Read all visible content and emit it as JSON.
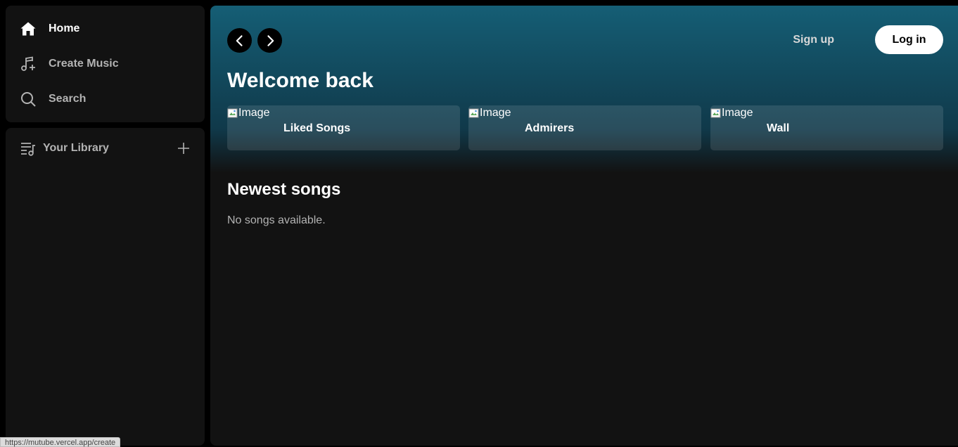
{
  "sidebar": {
    "nav": [
      {
        "label": "Home",
        "icon": "home-icon",
        "active": true
      },
      {
        "label": "Create Music",
        "icon": "music-plus-icon",
        "active": false
      },
      {
        "label": "Search",
        "icon": "search-icon",
        "active": false
      }
    ],
    "library": {
      "label": "Your Library",
      "icon": "library-icon",
      "add_icon": "plus-icon"
    }
  },
  "header": {
    "back_icon": "chevron-left-icon",
    "forward_icon": "chevron-right-icon",
    "signup_label": "Sign up",
    "login_label": "Log in"
  },
  "main": {
    "welcome_title": "Welcome back",
    "cards": [
      {
        "image_alt": "Image",
        "title": "Liked Songs"
      },
      {
        "image_alt": "Image",
        "title": "Admirers"
      },
      {
        "image_alt": "Image",
        "title": "Wall"
      }
    ],
    "newest_title": "Newest songs",
    "empty_message": "No songs available."
  },
  "status_bar": {
    "url": "https://mutube.vercel.app/create"
  },
  "colors": {
    "background": "#000000",
    "panel": "#121212",
    "gradient_top": "#155e75",
    "text_primary": "#ffffff",
    "text_secondary": "#b3b3b3"
  }
}
